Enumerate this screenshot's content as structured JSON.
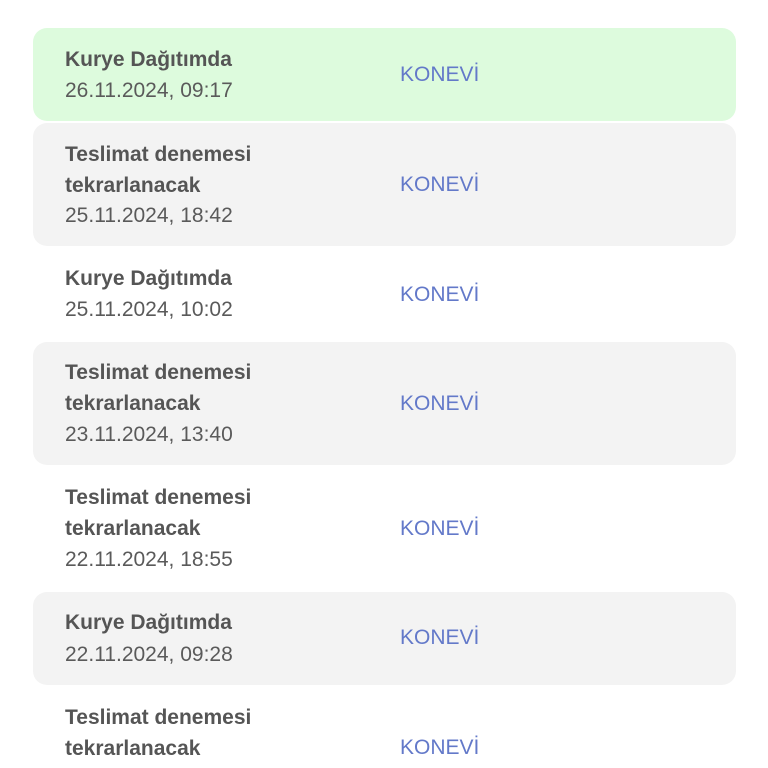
{
  "colors": {
    "highlight_bg": "#ddfbdd",
    "shaded_bg": "#f3f3f3",
    "status_text": "#555555",
    "date_text": "#5a5a5a",
    "location_link": "#6379c9"
  },
  "events": [
    {
      "status": "Kurye Dağıtımda",
      "date": "26.11.2024, 09:17",
      "location": "KONEVİ"
    },
    {
      "status": "Teslimat denemesi\ntekrarlanacak",
      "date": "25.11.2024, 18:42",
      "location": "KONEVİ"
    },
    {
      "status": "Kurye Dağıtımda",
      "date": "25.11.2024, 10:02",
      "location": "KONEVİ"
    },
    {
      "status": "Teslimat denemesi\ntekrarlanacak",
      "date": "23.11.2024, 13:40",
      "location": "KONEVİ"
    },
    {
      "status": "Teslimat denemesi\ntekrarlanacak",
      "date": "22.11.2024, 18:55",
      "location": "KONEVİ"
    },
    {
      "status": "Kurye Dağıtımda",
      "date": "22.11.2024, 09:28",
      "location": "KONEVİ"
    },
    {
      "status": "Teslimat denemesi\ntekrarlanacak",
      "date": "",
      "location": "KONEVİ"
    }
  ]
}
